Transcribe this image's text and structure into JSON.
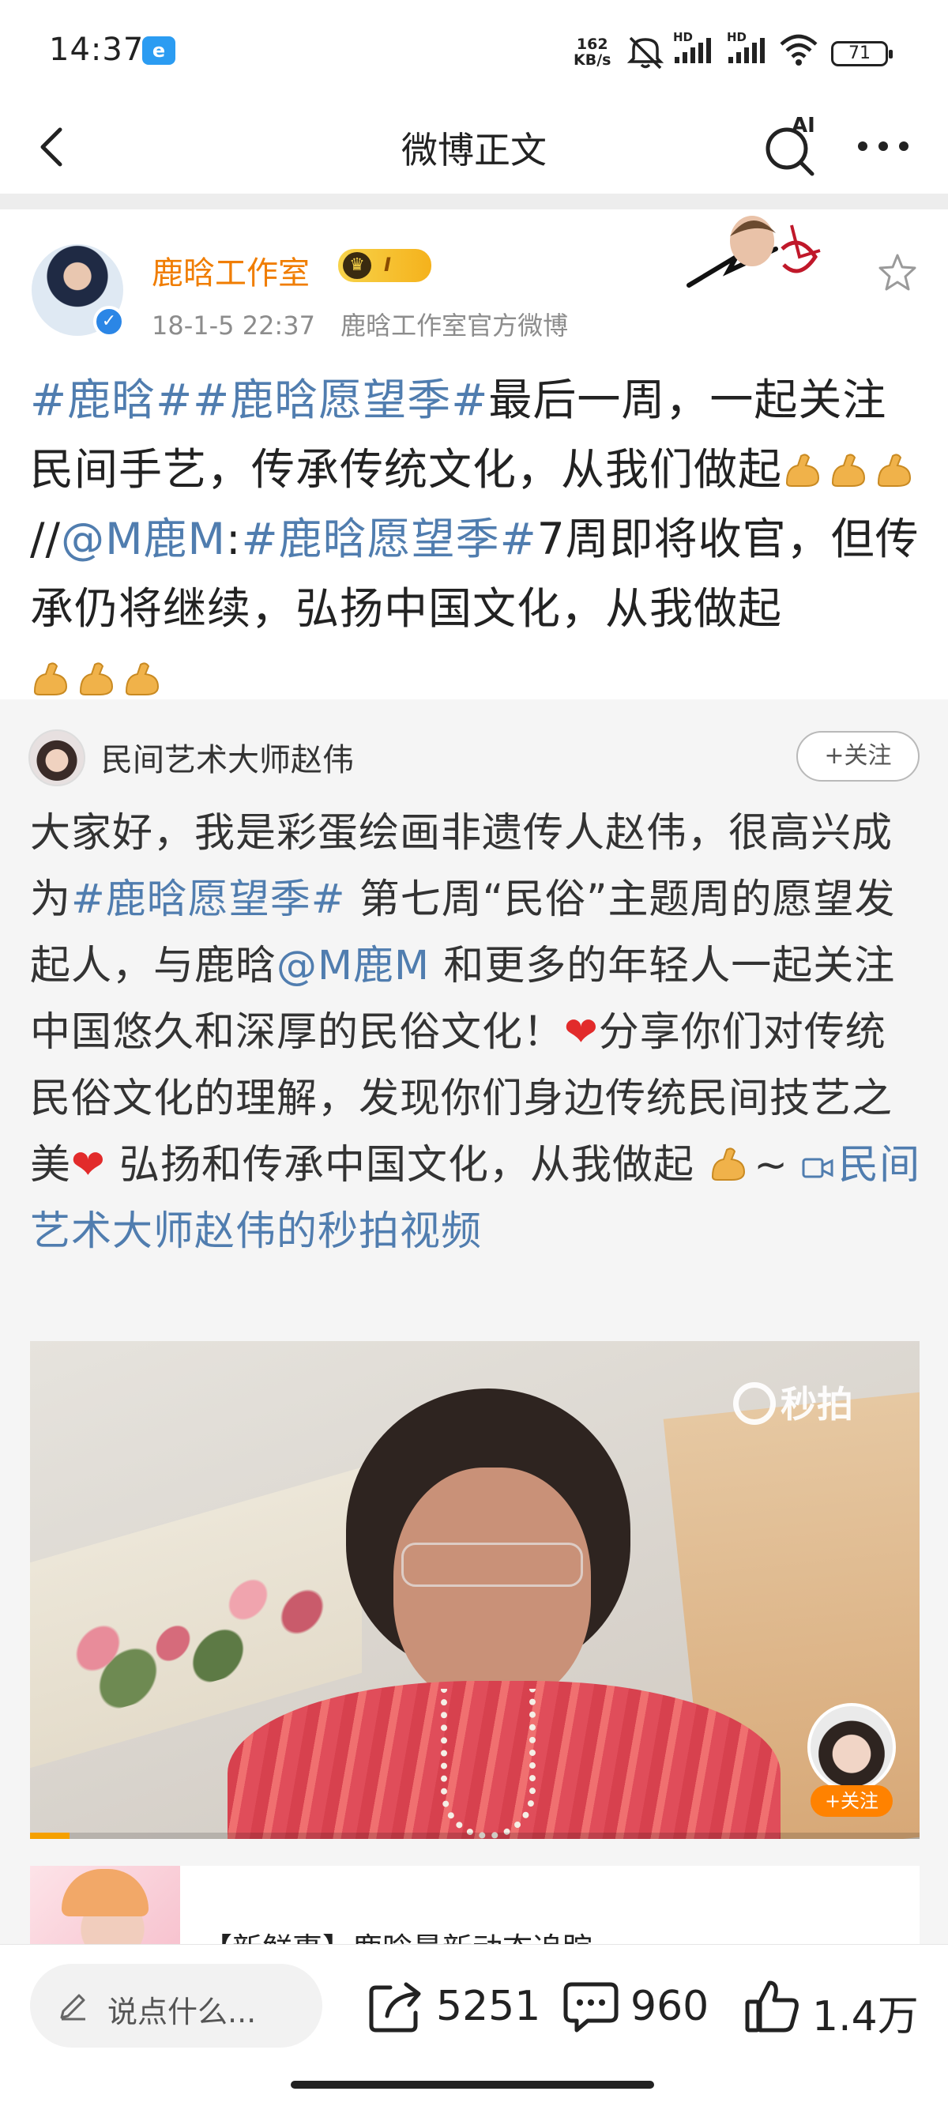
{
  "status_bar": {
    "time": "14:37",
    "app_badge": "e",
    "net_speed_value": "162",
    "net_speed_unit": "KB/s",
    "signal_label_1": "HD",
    "signal_label_2": "HD",
    "battery": "71"
  },
  "nav": {
    "title": "微博正文",
    "ai_label": "AI"
  },
  "post": {
    "author": "鹿晗工作室",
    "vip_level": "I",
    "date": "18-1-5 22:37",
    "source": "鹿晗工作室官方微博",
    "text_segments": [
      {
        "t": "#鹿晗#",
        "link": true
      },
      {
        "t": "#鹿晗愿望季#",
        "link": true
      },
      {
        "t": "最后一周，一起关注民间手艺，传承传统文化，从我们做起",
        "link": false
      },
      {
        "t": "//",
        "link": false
      },
      {
        "t": "@M鹿M",
        "link": true
      },
      {
        "t": ":",
        "link": false
      },
      {
        "t": "#鹿晗愿望季#",
        "link": true
      },
      {
        "t": "7周即将收官，但传承仍将继续，弘扬中国文化，从我做起",
        "link": false
      }
    ]
  },
  "retweet": {
    "author": "民间艺术大师赵伟",
    "follow_label": "+关注",
    "text_parts": {
      "p1": "大家好，我是彩蛋绘画非遗传人赵伟，很高兴成为",
      "link1": "#鹿晗愿望季#",
      "p2": " 第七周“民俗”主题周的愿望发起人，与鹿晗",
      "link2": "@M鹿M",
      "p3": " 和更多的年轻人一起关注中国悠久和深厚的民俗文化！",
      "p4": "分享你们对传统民俗文化的理解，发现你们身边传统民间技艺之美",
      "p5": " 弘扬和传承中国文化，从我做起 ",
      "p6": "~ ",
      "video_link": "民间艺术大师赵伟的秒拍视频"
    },
    "video": {
      "watermark": "秒拍",
      "uploader_follow": "+关注",
      "progress": 0.044
    },
    "news_card": {
      "title": "【新鲜事】鹿晗最新动态追踪"
    }
  },
  "toolbar": {
    "comment_placeholder": "说点什么...",
    "repost_count": "5251",
    "comment_count": "960",
    "like_count": "1.4万"
  },
  "colors": {
    "link": "#507daf",
    "author": "#f07d00",
    "follow_orange": "#ff8200"
  }
}
